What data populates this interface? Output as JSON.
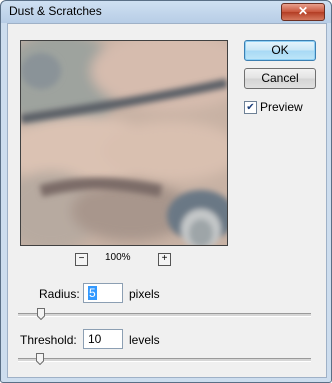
{
  "window": {
    "title": "Dust & Scratches",
    "close_label": "✕"
  },
  "buttons": {
    "ok": "OK",
    "cancel": "Cancel"
  },
  "preview": {
    "label": "Preview",
    "checked": true,
    "zoom": "100%",
    "zoom_out": "−",
    "zoom_in": "+"
  },
  "radius": {
    "label": "Radius:",
    "value": "5",
    "unit": "pixels"
  },
  "threshold": {
    "label": "Threshold:",
    "value": "10",
    "unit": "levels"
  },
  "icons": {
    "close": "close-icon",
    "check": "check-icon",
    "zoom_out": "zoom-out-icon",
    "zoom_in": "zoom-in-icon"
  }
}
